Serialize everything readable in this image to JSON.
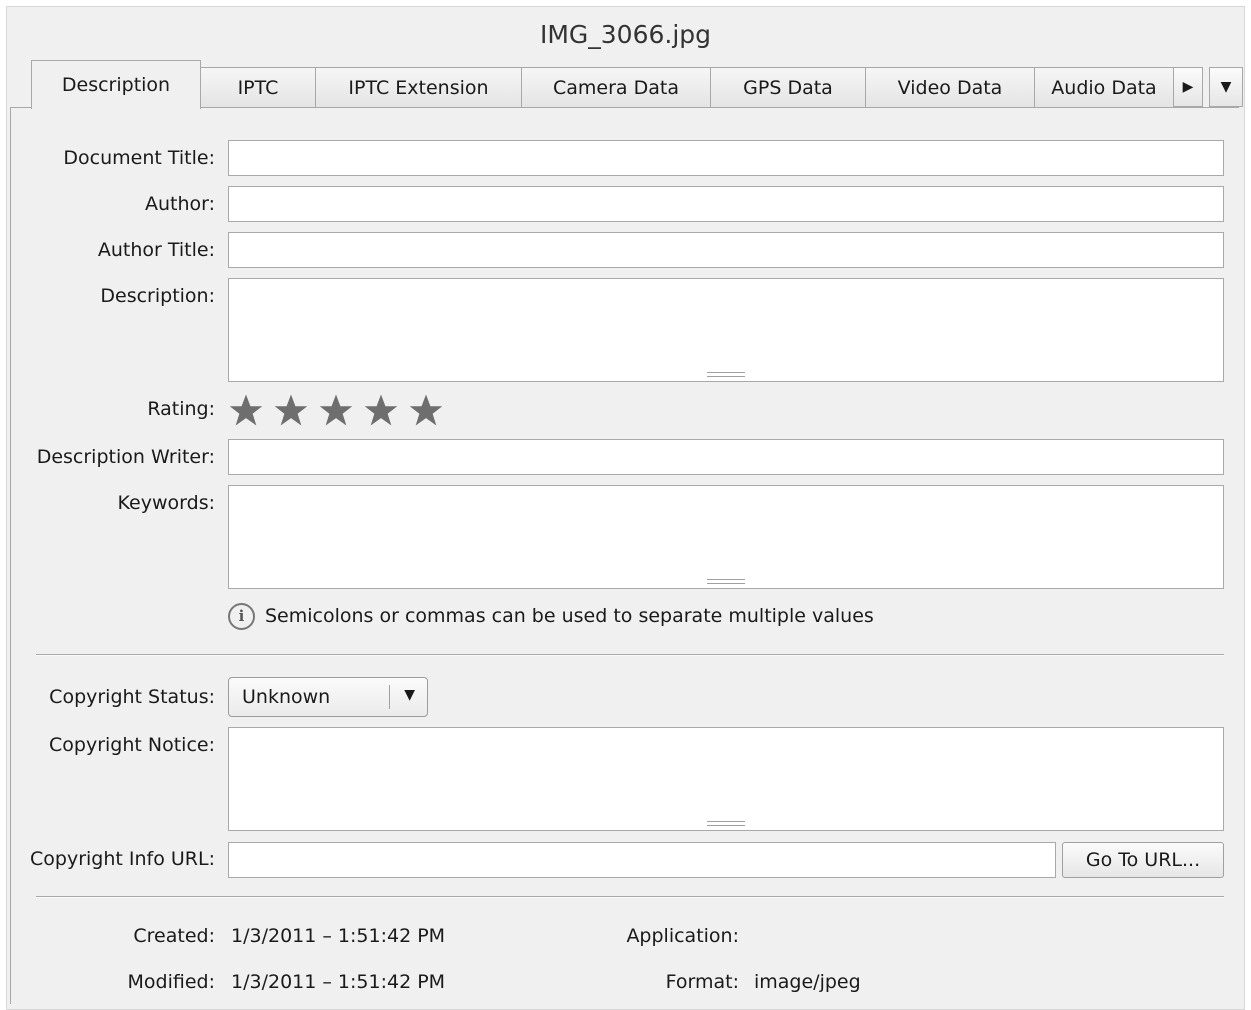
{
  "window": {
    "title": "IMG_3066.jpg"
  },
  "tabs": [
    {
      "label": "Description"
    },
    {
      "label": "IPTC"
    },
    {
      "label": "IPTC Extension"
    },
    {
      "label": "Camera Data"
    },
    {
      "label": "GPS Data"
    },
    {
      "label": "Video Data"
    },
    {
      "label": "Audio Data"
    }
  ],
  "tab_scroll": {
    "next_icon": "triangle-right-icon",
    "menu_icon": "chevron-down-icon"
  },
  "fields": {
    "document_title": {
      "label": "Document Title:",
      "value": ""
    },
    "author": {
      "label": "Author:",
      "value": ""
    },
    "author_title": {
      "label": "Author Title:",
      "value": ""
    },
    "description": {
      "label": "Description:",
      "value": ""
    },
    "rating": {
      "label": "Rating:",
      "stars_total": 5,
      "stars_filled": 0
    },
    "description_writer": {
      "label": "Description Writer:",
      "value": ""
    },
    "keywords": {
      "label": "Keywords:",
      "value": ""
    },
    "copyright_status": {
      "label": "Copyright Status:",
      "value": "Unknown"
    },
    "copyright_notice": {
      "label": "Copyright Notice:",
      "value": ""
    },
    "copyright_url": {
      "label": "Copyright Info URL:",
      "value": ""
    }
  },
  "hint": {
    "icon": "info-icon",
    "text": "Semicolons or commas can be used to separate multiple values"
  },
  "go_to_url": {
    "label": "Go To URL..."
  },
  "meta": {
    "created_label": "Created:",
    "created_value": "1/3/2011 – 1:51:42 PM",
    "modified_label": "Modified:",
    "modified_value": "1/3/2011 – 1:51:42 PM",
    "application_label": "Application:",
    "application_value": "",
    "format_label": "Format:",
    "format_value": "image/jpeg"
  },
  "colors": {
    "star": "#6e6e6e",
    "panel": "#f0f0f0",
    "border": "#a8a8a8"
  }
}
